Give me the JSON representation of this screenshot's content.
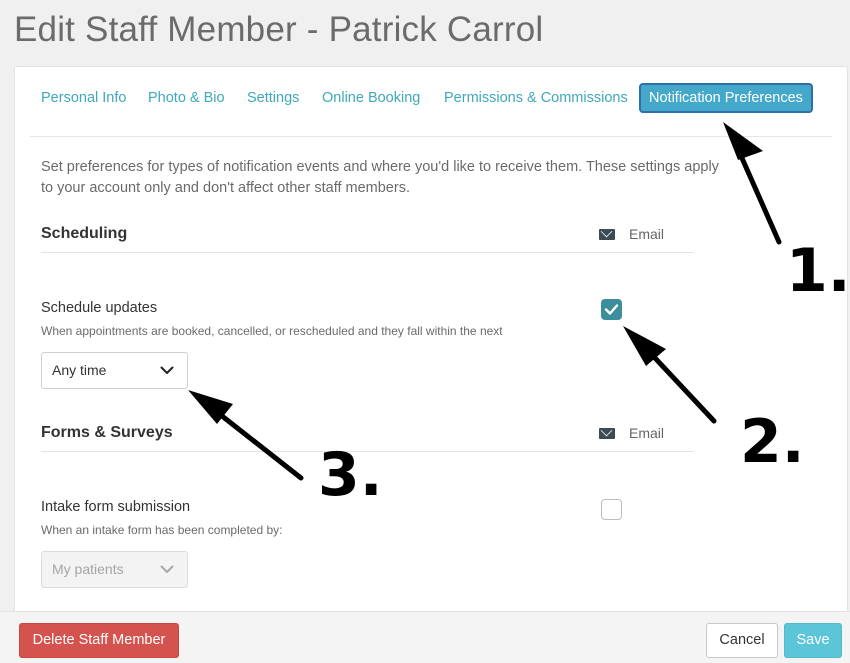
{
  "page": {
    "title": "Edit Staff Member - Patrick Carrol"
  },
  "tabs": [
    {
      "label": "Personal Info"
    },
    {
      "label": "Photo & Bio"
    },
    {
      "label": "Settings"
    },
    {
      "label": "Online Booking"
    },
    {
      "label": "Permissions & Commissions"
    },
    {
      "label": "Notification Preferences",
      "active": true
    }
  ],
  "intro": "Set preferences for types of notification events and where you'd like to receive them. These settings apply to your account only and don't affect other staff members.",
  "sections": {
    "scheduling": {
      "title": "Scheduling",
      "email_label": "Email",
      "item": {
        "title": "Schedule updates",
        "subtitle": "When appointments are booked, cancelled, or rescheduled and they fall within the next",
        "select_value": "Any time",
        "email_checked": true
      }
    },
    "forms": {
      "title": "Forms & Surveys",
      "email_label": "Email",
      "item": {
        "title": "Intake form submission",
        "subtitle": "When an intake form has been completed by:",
        "select_value": "My patients",
        "email_checked": false
      }
    }
  },
  "footer": {
    "delete_label": "Delete Staff Member",
    "cancel_label": "Cancel",
    "save_label": "Save"
  },
  "annotations": {
    "step1": "1.",
    "step2": "2.",
    "step3": "3."
  },
  "colors": {
    "accent": "#3ea9b9",
    "active_tab_bg": "#43a8c9",
    "danger": "#d4534e",
    "save": "#5cc5d7",
    "checkbox": "#3d8e9d"
  }
}
